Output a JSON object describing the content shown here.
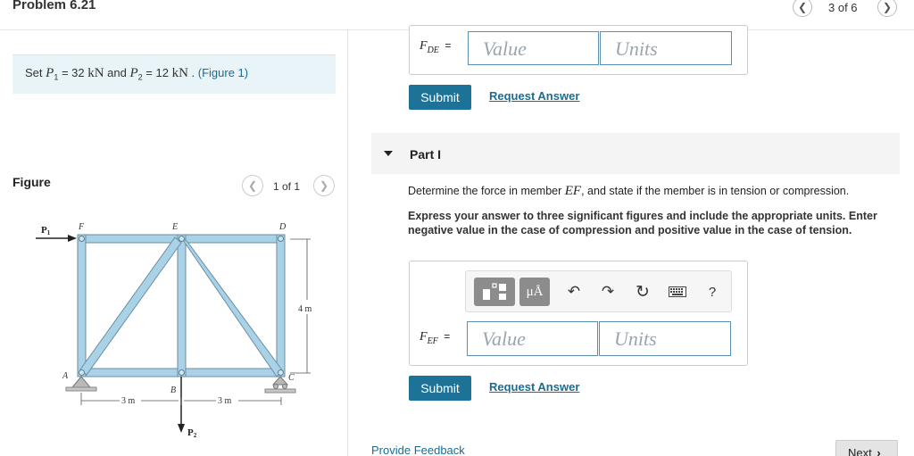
{
  "header": {
    "title": "Problem 6.21",
    "page_indicator": "3 of 6",
    "prev_icon": "chevron-left-icon",
    "next_icon": "chevron-right-icon"
  },
  "given": {
    "prefix": "Set",
    "p1_symbol": "P",
    "p1_sub": "1",
    "p1_value": " = 32 ",
    "p1_unit": "kN",
    "and": " and ",
    "p2_symbol": "P",
    "p2_sub": "2",
    "p2_value": " = 12 ",
    "p2_unit": "kN",
    "period": " . ",
    "figure_link": "(Figure 1)"
  },
  "figure": {
    "heading": "Figure",
    "count": "1 of 1",
    "labels": {
      "p1": "P",
      "p1_sub": "1",
      "p2": "P",
      "p2_sub": "2",
      "A": "A",
      "B": "B",
      "C": "C",
      "D": "D",
      "E": "E",
      "F": "F",
      "height": "4 m",
      "span_left": "3 m",
      "span_right": "3 m"
    }
  },
  "prev_part": {
    "var": "F",
    "var_sub": "DE",
    "equals": "=",
    "value_placeholder": "Value",
    "units_placeholder": "Units",
    "submit": "Submit",
    "request": "Request Answer"
  },
  "part": {
    "label": "Part I",
    "toggle_icon": "caret-down-icon",
    "question_pre": "Determine the force in member ",
    "question_member": "EF",
    "question_post": ", and state if the member is in tension or compression.",
    "instructions": "Express your answer to three significant figures and include the appropriate units. Enter negative value in the case of compression and positive value in the case of tension.",
    "toolbar": {
      "template_icon": "templates-icon",
      "units_label": "μÅ",
      "undo_icon": "undo-icon",
      "redo_icon": "redo-icon",
      "reset_icon": "reset-icon",
      "keyboard_icon": "keyboard-icon",
      "help_label": "?"
    },
    "var": "F",
    "var_sub": "EF",
    "equals": "=",
    "value_placeholder": "Value",
    "units_placeholder": "Units",
    "submit": "Submit",
    "request": "Request Answer"
  },
  "footer": {
    "feedback": "Provide Feedback",
    "next": "Next",
    "next_icon": "chevron-right-icon"
  },
  "colors": {
    "accent": "#1d7298",
    "truss": "#a9d2e6",
    "given_bg": "#e9f4f8"
  }
}
